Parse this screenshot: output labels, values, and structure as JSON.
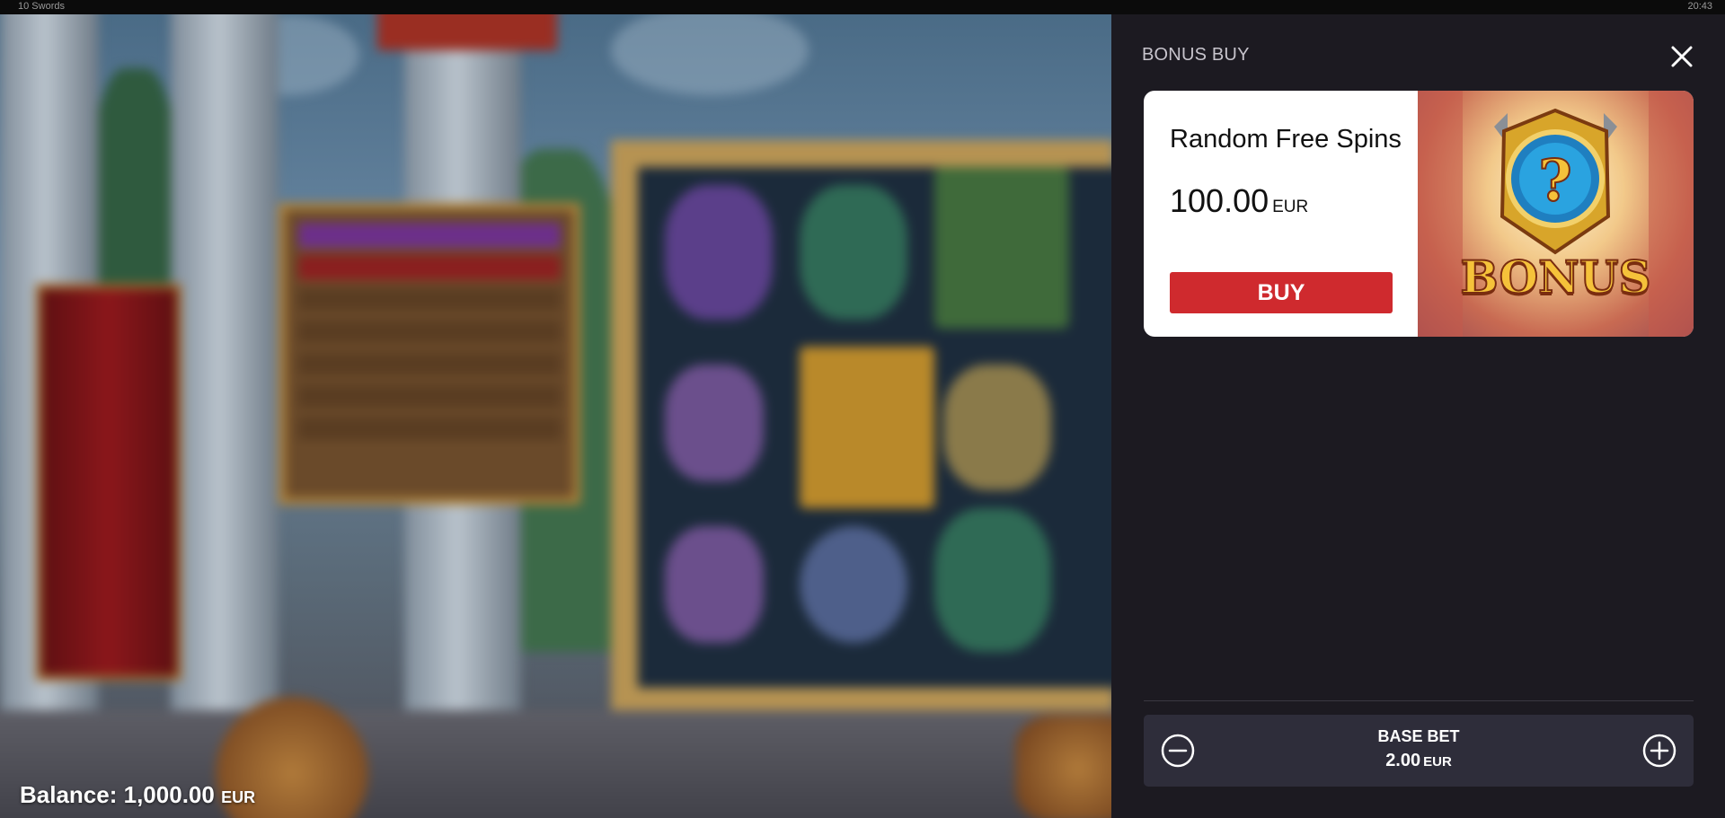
{
  "window": {
    "title": "10 Swords",
    "clock": "20:43"
  },
  "game": {
    "balance_label": "Balance:",
    "balance_value": "1,000.00",
    "balance_currency": "EUR"
  },
  "bonus_panel": {
    "title": "BONUS BUY",
    "close_icon": "close-icon",
    "offer": {
      "name": "Random Free Spins",
      "price": "100.00",
      "currency": "EUR",
      "buy_label": "BUY",
      "image_text": "BONUS",
      "image_symbol": "?"
    },
    "base_bet": {
      "label": "BASE BET",
      "value": "2.00",
      "currency": "EUR",
      "decrease_icon": "minus-circle-icon",
      "increase_icon": "plus-circle-icon"
    }
  },
  "colors": {
    "panel_bg": "#1c1a21",
    "buy_button": "#cf2a2e",
    "bet_bar": "#2e2d3a",
    "card_bg": "#ffffff"
  }
}
